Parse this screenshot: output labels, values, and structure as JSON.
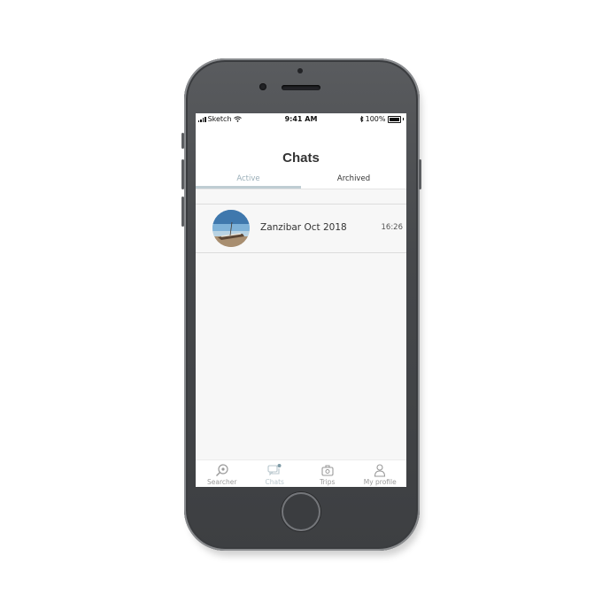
{
  "status_bar": {
    "carrier": "Sketch",
    "time": "9:41 AM",
    "battery": "100%"
  },
  "header": {
    "title": "Chats",
    "tabs": [
      {
        "label": "Active",
        "selected": true
      },
      {
        "label": "Archived",
        "selected": false
      }
    ]
  },
  "chats": [
    {
      "name": "Zanzibar Oct 2018",
      "time": "16:26",
      "avatar": "beach-boat-photo"
    }
  ],
  "bottom_nav": {
    "items": [
      {
        "label": "Searcher",
        "icon": "search-pin-icon",
        "selected": false
      },
      {
        "label": "Chats",
        "icon": "chat-bubbles-icon",
        "selected": true
      },
      {
        "label": "Trips",
        "icon": "suitcase-icon",
        "selected": false
      },
      {
        "label": "My profile",
        "icon": "user-icon",
        "selected": false
      }
    ]
  },
  "colors": {
    "accent": "#9aaeb8",
    "tab_underline": "#bfcdd3",
    "screen_bg": "#f7f7f7"
  }
}
